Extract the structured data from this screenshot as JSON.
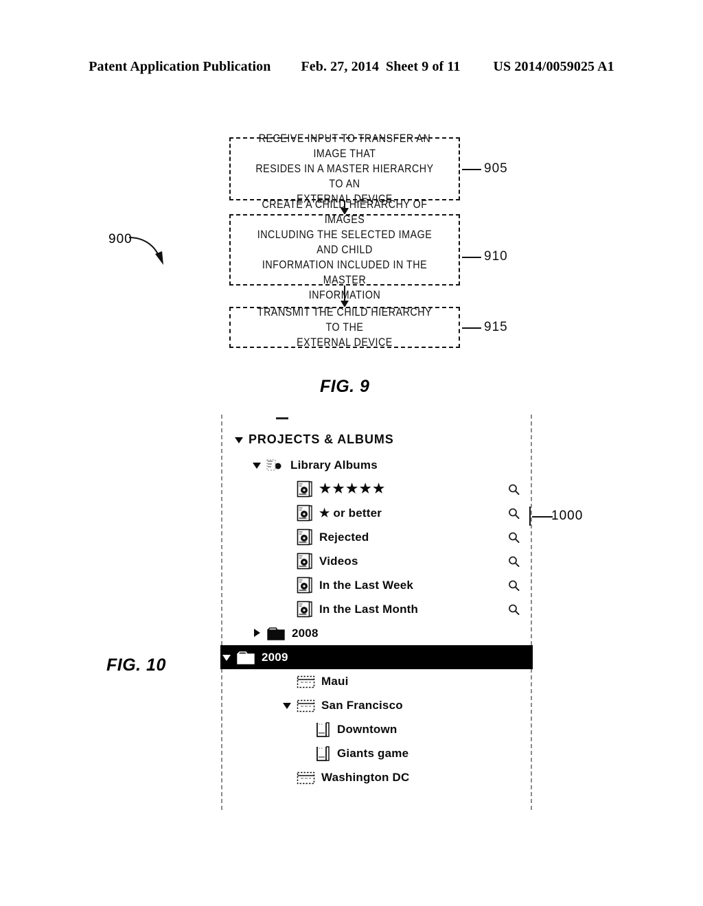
{
  "header": {
    "publication": "Patent Application Publication",
    "date": "Feb. 27, 2014",
    "sheet": "Sheet 9 of 11",
    "patent_number": "US 2014/0059025 A1"
  },
  "figure9": {
    "label": "FIG. 9",
    "diagram_ref": "900",
    "steps": [
      {
        "ref": "905",
        "lines": [
          "RECEIVE INPUT TO TRANSFER AN IMAGE THAT",
          "RESIDES IN A MASTER HIERARCHY TO AN",
          "EXTERNAL DEVICE"
        ]
      },
      {
        "ref": "910",
        "lines": [
          "CREATE A CHILD HIERARCHY OF IMAGES",
          "INCLUDING THE SELECTED IMAGE AND CHILD",
          "INFORMATION INCLUDED IN THE MASTER",
          "INFORMATION"
        ]
      },
      {
        "ref": "915",
        "lines": [
          "TRANSMIT THE CHILD HIERARCHY TO THE",
          "EXTERNAL DEVICE"
        ]
      }
    ]
  },
  "figure10": {
    "label": "FIG. 10",
    "panel_ref": "1000",
    "tree": [
      {
        "id": "projects-albums",
        "label": "PROJECTS & ALBUMS",
        "indent": 0,
        "disclosure": "down",
        "icon": "",
        "selected": false,
        "magnifier": false,
        "header": true
      },
      {
        "id": "library-albums",
        "label": "Library Albums",
        "indent": 1,
        "disclosure": "down",
        "icon": "gear-small-icon",
        "selected": false,
        "magnifier": false
      },
      {
        "id": "five-stars",
        "label": "★★★★★",
        "indent": 2,
        "disclosure": "none",
        "icon": "album-icon",
        "selected": false,
        "magnifier": true,
        "stars": true
      },
      {
        "id": "one-star-or-better",
        "label": "★ or better",
        "indent": 2,
        "disclosure": "none",
        "icon": "album-icon",
        "selected": false,
        "magnifier": true
      },
      {
        "id": "rejected",
        "label": "Rejected",
        "indent": 2,
        "disclosure": "none",
        "icon": "album-icon",
        "selected": false,
        "magnifier": true
      },
      {
        "id": "videos",
        "label": "Videos",
        "indent": 2,
        "disclosure": "none",
        "icon": "album-icon",
        "selected": false,
        "magnifier": true
      },
      {
        "id": "in-the-last-week",
        "label": "In the Last Week",
        "indent": 2,
        "disclosure": "none",
        "icon": "album-icon",
        "selected": false,
        "magnifier": true
      },
      {
        "id": "in-the-last-month",
        "label": "In the Last Month",
        "indent": 2,
        "disclosure": "none",
        "icon": "album-icon",
        "selected": false,
        "magnifier": true
      },
      {
        "id": "folder-2008",
        "label": "2008",
        "indent": 1,
        "disclosure": "right",
        "icon": "folder-icon",
        "selected": false,
        "magnifier": false
      },
      {
        "id": "folder-2009",
        "label": "2009",
        "indent": 1,
        "disclosure": "down",
        "icon": "folder-icon",
        "selected": true,
        "magnifier": false
      },
      {
        "id": "project-maui",
        "label": "Maui",
        "indent": 2,
        "disclosure": "none",
        "icon": "project-icon",
        "selected": false,
        "magnifier": false
      },
      {
        "id": "project-san-francisco",
        "label": "San Francisco",
        "indent": 2,
        "disclosure": "down",
        "icon": "project-icon",
        "selected": false,
        "magnifier": false,
        "tri_before": true
      },
      {
        "id": "album-downtown",
        "label": "Downtown",
        "indent": 3,
        "disclosure": "none",
        "icon": "book-album-icon",
        "selected": false,
        "magnifier": false
      },
      {
        "id": "album-giants-game",
        "label": "Giants game",
        "indent": 3,
        "disclosure": "none",
        "icon": "book-album-icon",
        "selected": false,
        "magnifier": false
      },
      {
        "id": "project-washington-dc",
        "label": "Washington DC",
        "indent": 2,
        "disclosure": "none",
        "icon": "project-icon",
        "selected": false,
        "magnifier": false
      }
    ]
  },
  "colors": {
    "ink": "#000000",
    "selection": "#000000",
    "selection_text": "#ffffff",
    "panel_border": "#8a8a8a"
  }
}
